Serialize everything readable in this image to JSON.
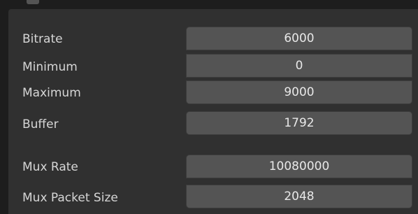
{
  "settings": {
    "fields": [
      {
        "label": "Bitrate",
        "value": "6000"
      },
      {
        "label": "Minimum",
        "value": "0"
      },
      {
        "label": "Maximum",
        "value": "9000"
      },
      {
        "label": "Buffer",
        "value": "1792"
      },
      {
        "label": "Mux Rate",
        "value": "10080000"
      },
      {
        "label": "Mux Packet Size",
        "value": "2048"
      }
    ]
  }
}
